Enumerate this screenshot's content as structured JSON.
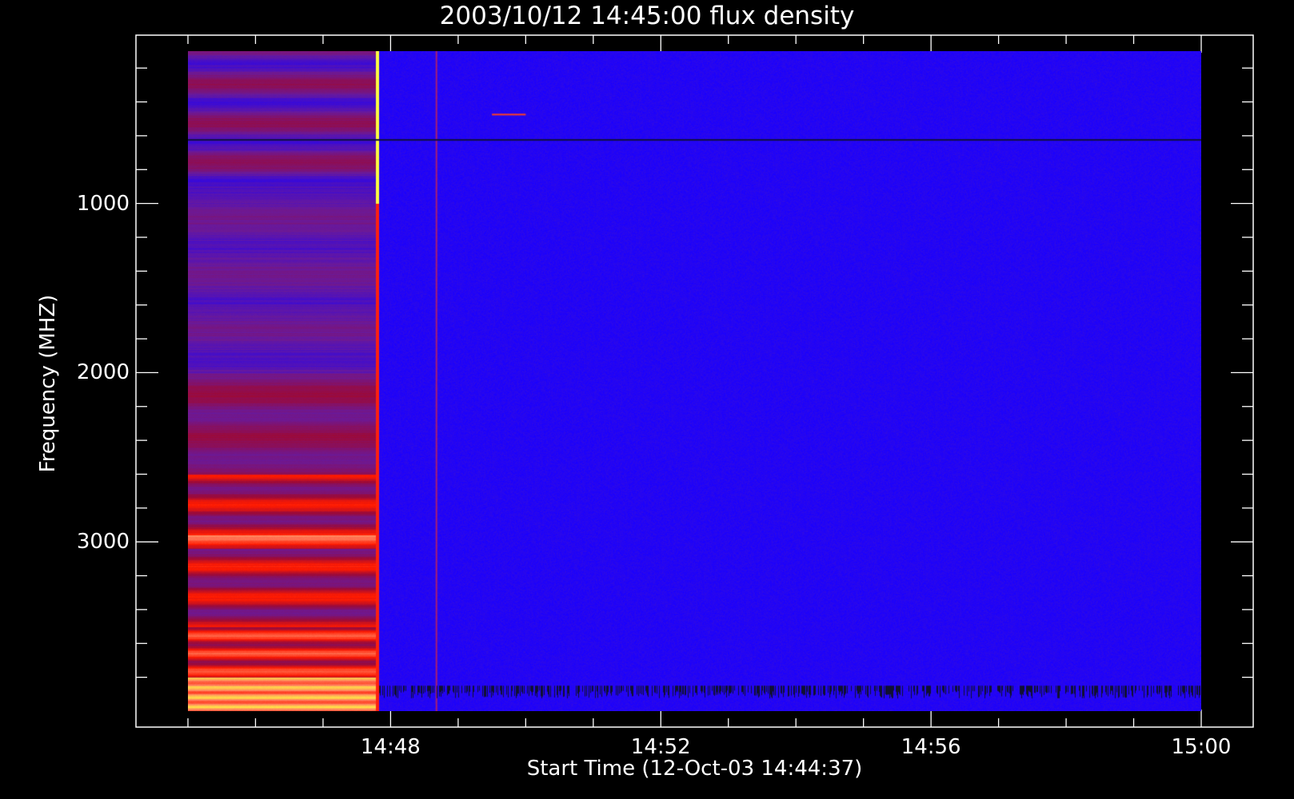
{
  "chart_data": {
    "type": "heatmap",
    "title": "2003/10/12 14:45:00 flux density",
    "xlabel": "Start Time (12-Oct-03 14:44:37)",
    "ylabel": "Frequency (MHZ)",
    "x_range": [
      "14:45:00",
      "15:00:00"
    ],
    "y_range_mhz": [
      100,
      4000
    ],
    "y_axis_inverted": true,
    "x_ticks": [
      {
        "label": "14:48",
        "value": "14:48"
      },
      {
        "label": "14:52",
        "value": "14:52"
      },
      {
        "label": "14:56",
        "value": "14:56"
      },
      {
        "label": "15:00",
        "value": "15:00"
      }
    ],
    "y_ticks": [
      {
        "label": "1000",
        "value": 1000
      },
      {
        "label": "2000",
        "value": 2000
      },
      {
        "label": "3000",
        "value": 3000
      }
    ],
    "colormap": [
      "#1a00ff",
      "#6a1a9a",
      "#9b0a3a",
      "#ff1a00",
      "#ff8060",
      "#ffff40"
    ],
    "background_color": "#1a00ff",
    "burst_end_time": "14:47:50",
    "features": [
      {
        "type": "time_column",
        "time": "14:48:40",
        "color": "#ff3020"
      },
      {
        "type": "freq_line",
        "freq_mhz": 620,
        "color": "#101040"
      },
      {
        "type": "short_segment",
        "time_start": "14:49:30",
        "time_end": "14:50:00",
        "freq_mhz": 470,
        "color": "#ff4020"
      }
    ]
  }
}
